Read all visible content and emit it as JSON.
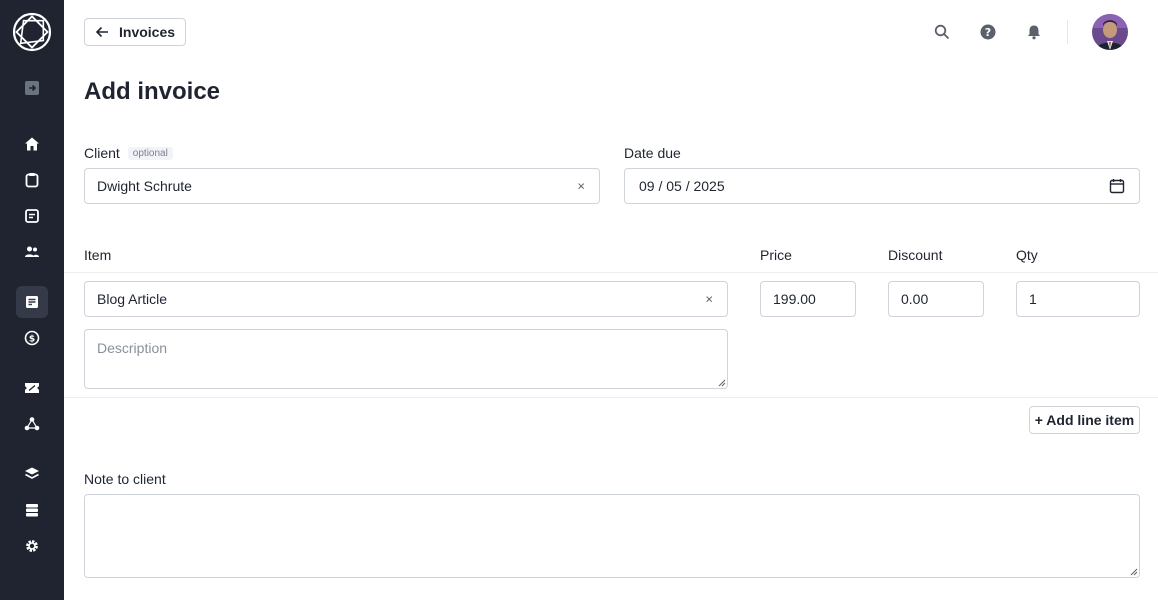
{
  "header": {
    "back_label": "Invoices",
    "title": "Add invoice"
  },
  "sidebar": {
    "items": [
      {
        "name": "collapse-icon"
      },
      {
        "name": "home-icon"
      },
      {
        "name": "clipboard-icon"
      },
      {
        "name": "document-icon"
      },
      {
        "name": "users-icon"
      },
      {
        "name": "invoice-icon",
        "active": true
      },
      {
        "name": "dollar-icon"
      },
      {
        "name": "ticket-icon"
      },
      {
        "name": "network-icon"
      },
      {
        "name": "layers-icon"
      },
      {
        "name": "storage-icon"
      },
      {
        "name": "gear-icon"
      }
    ]
  },
  "form": {
    "client_label": "Client",
    "client_optional": "optional",
    "client_value": "Dwight Schrute",
    "date_label": "Date due",
    "date_value": "09 / 05 / 2025",
    "item_col": "Item",
    "price_col": "Price",
    "discount_col": "Discount",
    "qty_col": "Qty",
    "line_items": [
      {
        "item": "Blog Article",
        "price": "199.00",
        "discount": "0.00",
        "qty": "1",
        "description_placeholder": "Description"
      }
    ],
    "add_line_label": "+ Add line item",
    "note_label": "Note to client",
    "clear_symbol": "×"
  },
  "colors": {
    "sidebar_bg": "#1f2430",
    "sidebar_active": "#343a47",
    "border": "#cfd3da"
  }
}
